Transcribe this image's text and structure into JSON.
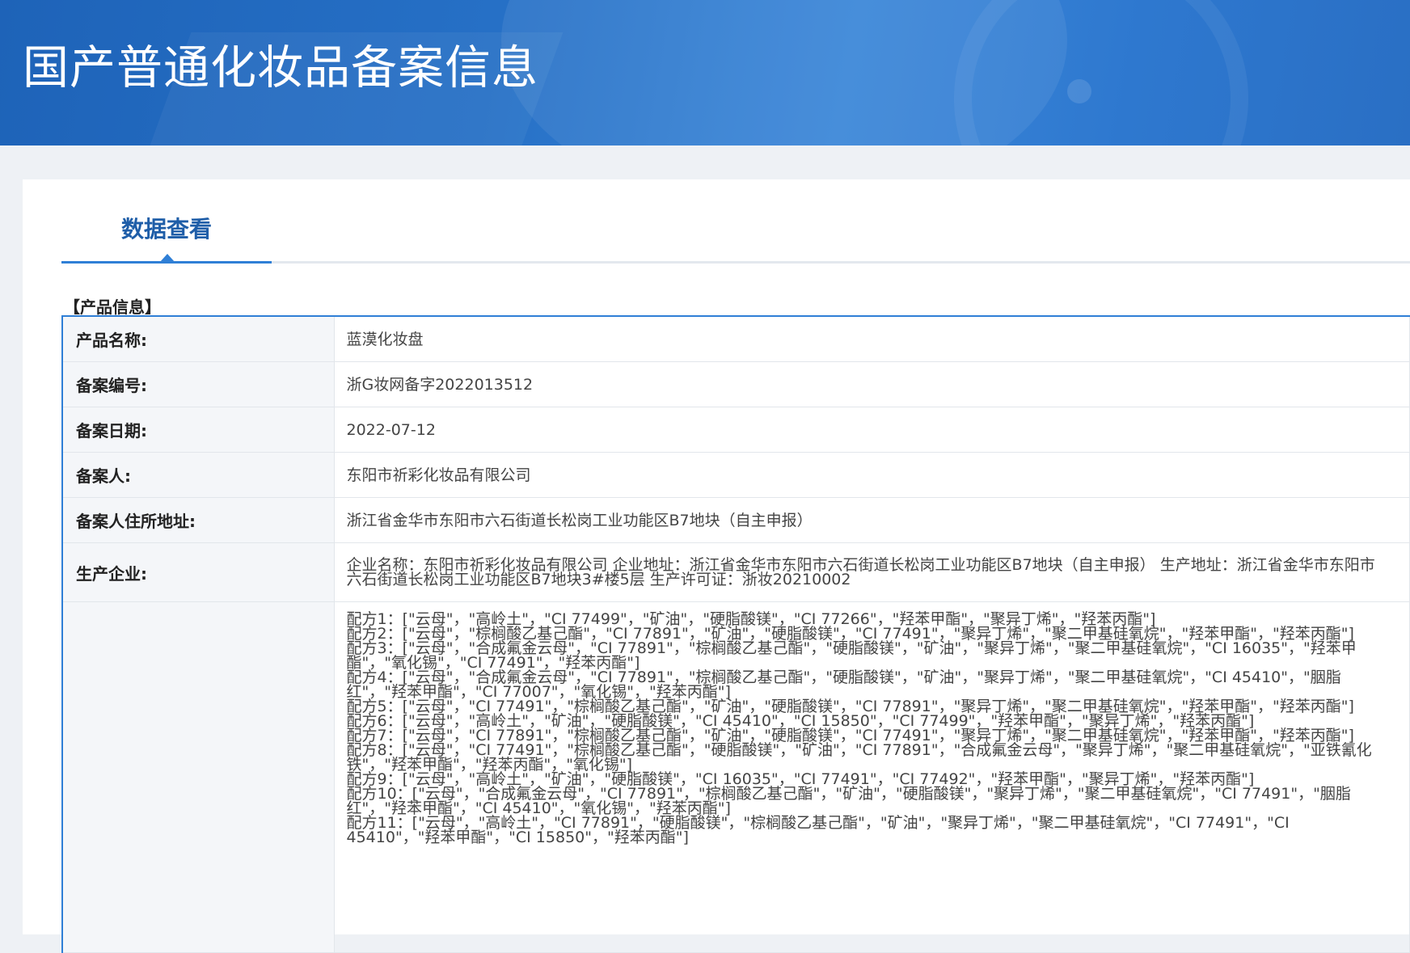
{
  "header": {
    "title": "国产普通化妆品备案信息"
  },
  "tabs": [
    {
      "label": "数据查看",
      "active": true
    }
  ],
  "section": {
    "title": "【产品信息】"
  },
  "product": {
    "rows": [
      {
        "label": "产品名称:",
        "value": "蓝漠化妆盘"
      },
      {
        "label": "备案编号:",
        "value": "浙G妆网备字2022013512"
      },
      {
        "label": "备案日期:",
        "value": "2022-07-12"
      },
      {
        "label": "备案人:",
        "value": "东阳市祈彩化妆品有限公司"
      },
      {
        "label": "备案人住所地址:",
        "value": "浙江省金华市东阳市六石街道长松岗工业功能区B7地块（自主申报）"
      }
    ],
    "manufacturer": {
      "label": "生产企业:",
      "value": "企业名称：东阳市祈彩化妆品有限公司 企业地址：浙江省金华市东阳市六石街道长松岗工业功能区B7地块（自主申报） 生产地址：浙江省金华市东阳市六石街道长松岗工业功能区B7地块3#楼5层 生产许可证：浙妆20210002"
    },
    "formulas": {
      "label": "",
      "lines": [
        "配方1：[\"云母\"，\"高岭土\"，\"CI 77499\"，\"矿油\"，\"硬脂酸镁\"，\"CI 77266\"，\"羟苯甲酯\"，\"聚异丁烯\"，\"羟苯丙酯\"]",
        "配方2：[\"云母\"，\"棕榈酸乙基己酯\"，\"CI 77891\"，\"矿油\"，\"硬脂酸镁\"，\"CI 77491\"，\"聚异丁烯\"，\"聚二甲基硅氧烷\"，\"羟苯甲酯\"，\"羟苯丙酯\"]",
        "配方3：[\"云母\"，\"合成氟金云母\"，\"CI 77891\"，\"棕榈酸乙基己酯\"，\"硬脂酸镁\"，\"矿油\"，\"聚异丁烯\"，\"聚二甲基硅氧烷\"，\"CI 16035\"，\"羟苯甲酯\"，\"氧化锡\"，\"CI 77491\"，\"羟苯丙酯\"]",
        "配方4：[\"云母\"，\"合成氟金云母\"，\"CI 77891\"，\"棕榈酸乙基己酯\"，\"硬脂酸镁\"，\"矿油\"，\"聚异丁烯\"，\"聚二甲基硅氧烷\"，\"CI 45410\"，\"胭脂红\"，\"羟苯甲酯\"，\"CI 77007\"，\"氧化锡\"，\"羟苯丙酯\"]",
        "配方5：[\"云母\"，\"CI 77491\"，\"棕榈酸乙基己酯\"，\"矿油\"，\"硬脂酸镁\"，\"CI 77891\"，\"聚异丁烯\"，\"聚二甲基硅氧烷\"，\"羟苯甲酯\"，\"羟苯丙酯\"]",
        "配方6：[\"云母\"，\"高岭土\"，\"矿油\"，\"硬脂酸镁\"，\"CI 45410\"，\"CI 15850\"，\"CI 77499\"，\"羟苯甲酯\"，\"聚异丁烯\"，\"羟苯丙酯\"]",
        "配方7：[\"云母\"，\"CI 77891\"，\"棕榈酸乙基己酯\"，\"矿油\"，\"硬脂酸镁\"，\"CI 77491\"，\"聚异丁烯\"，\"聚二甲基硅氧烷\"，\"羟苯甲酯\"，\"羟苯丙酯\"]",
        "配方8：[\"云母\"，\"CI 77491\"，\"棕榈酸乙基己酯\"，\"硬脂酸镁\"，\"矿油\"，\"CI 77891\"，\"合成氟金云母\"，\"聚异丁烯\"，\"聚二甲基硅氧烷\"，\"亚铁氰化铁\"，\"羟苯甲酯\"，\"羟苯丙酯\"，\"氧化锡\"]",
        "配方9：[\"云母\"，\"高岭土\"，\"矿油\"，\"硬脂酸镁\"，\"CI 16035\"，\"CI 77491\"，\"CI 77492\"，\"羟苯甲酯\"，\"聚异丁烯\"，\"羟苯丙酯\"]",
        "配方10：[\"云母\"，\"合成氟金云母\"，\"CI 77891\"，\"棕榈酸乙基己酯\"，\"矿油\"，\"硬脂酸镁\"，\"聚异丁烯\"，\"聚二甲基硅氧烷\"，\"CI 77491\"，\"胭脂红\"，\"羟苯甲酯\"，\"CI 45410\"，\"氧化锡\"，\"羟苯丙酯\"]",
        "配方11：[\"云母\"，\"高岭土\"，\"CI 77891\"，\"硬脂酸镁\"，\"棕榈酸乙基己酯\"，\"矿油\"，\"聚异丁烯\"，\"聚二甲基硅氧烷\"，\"CI 77491\"，\"CI 45410\"，\"羟苯甲酯\"，\"CI 15850\"，\"羟苯丙酯\"]"
      ]
    }
  },
  "colors": {
    "banner": "#2670c6",
    "accent": "#2f7fd6",
    "tab_text": "#1f5ea8",
    "label_bg": "#f4f6f9"
  }
}
